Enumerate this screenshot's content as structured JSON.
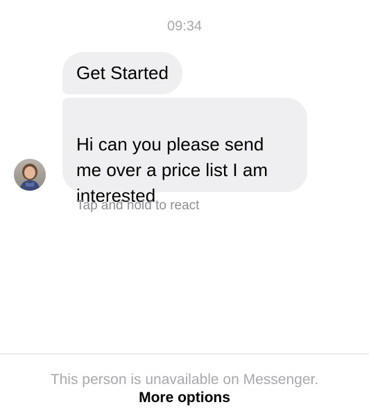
{
  "thread": {
    "timestamp": "09:34",
    "messages": [
      {
        "text": "Get Started"
      },
      {
        "text": "Hi can you please send\nme over a price list I am\ninterested"
      }
    ],
    "react_hint": "Tap and hold to react"
  },
  "footer": {
    "status": "This person is unavailable on Messenger.",
    "more_options": "More options"
  },
  "colors": {
    "bubble_background": "#efeff1",
    "muted_text": "#a8a8ad",
    "hint_text": "#8e8e93"
  }
}
